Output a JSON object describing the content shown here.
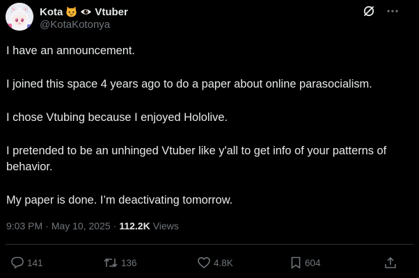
{
  "author": {
    "display_name": "Kota",
    "suffix_text": "Vtuber",
    "handle": "@KotaKotonya",
    "avatar_icon": "avatar-illustration-icon",
    "emoji_1": "cat-face-emoji-icon",
    "emoji_2": "eye-emoji-icon"
  },
  "top_actions": {
    "grok_icon": "slashed-circle-icon",
    "more_icon": "more-dots-icon"
  },
  "post": {
    "paragraphs": [
      "I have an announcement.",
      "I joined this space 4 years ago to do a paper about online parasocialism.",
      "I chose Vtubing because I enjoyed Hololive.",
      "I pretended to be an unhinged Vtuber like y'all to get info of your patterns of behavior.",
      "My paper is done. I’m deactivating tomorrow."
    ]
  },
  "meta": {
    "time": "9:03 PM",
    "separator": "·",
    "date": "May 10, 2025",
    "views_count": "112.2K",
    "views_label": "Views"
  },
  "engagement": {
    "replies": "141",
    "reposts": "136",
    "likes": "4.8K",
    "bookmarks": "604"
  },
  "colors": {
    "background": "#000000",
    "text_primary": "#e7e9ea",
    "text_secondary": "#71767b",
    "divider": "#2f3336"
  }
}
